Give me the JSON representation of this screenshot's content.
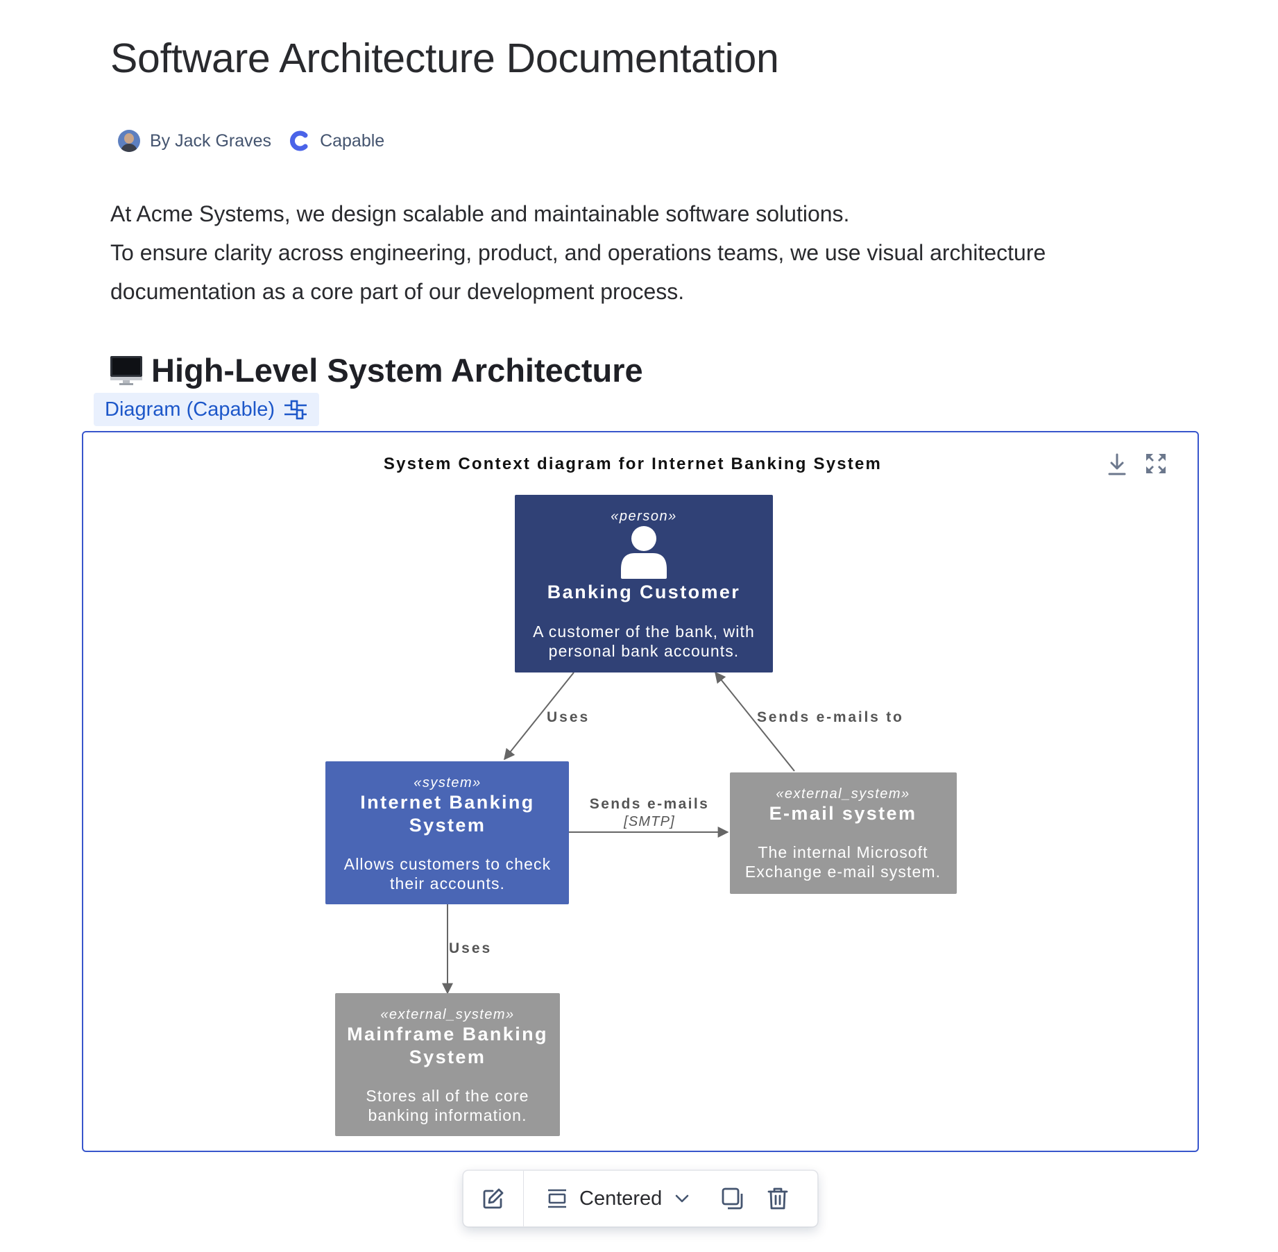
{
  "page": {
    "title": "Software Architecture Documentation",
    "byline": {
      "author": "By Jack Graves",
      "app_name": "Capable",
      "icons": [
        "author-avatar",
        "capable-logo-icon"
      ]
    },
    "intro_lines": [
      "At Acme Systems, we design scalable and maintainable software solutions.",
      "To ensure clarity across engineering, product, and operations teams, we use visual architecture documentation as a core part of our development process."
    ],
    "section_heading": "High-Level System Architecture",
    "section_heading_icon": "desktop-computer-icon",
    "macro_chip": {
      "label": "Diagram (Capable)",
      "icon": "settings-sliders-icon"
    }
  },
  "diagram": {
    "title": "System Context diagram for Internet Banking System",
    "tools": [
      "download-icon",
      "fullscreen-icon"
    ],
    "colors": {
      "person": "#304176",
      "system": "#4a66b5",
      "external": "#999999",
      "edge": "#666666"
    },
    "nodes": {
      "customer": {
        "stereotype": "«person»",
        "name": "Banking Customer",
        "desc": [
          "A customer of the bank, with",
          "personal bank accounts."
        ]
      },
      "ibs": {
        "stereotype": "«system»",
        "name": [
          "Internet Banking",
          "System"
        ],
        "desc": [
          "Allows customers to check",
          "their accounts."
        ]
      },
      "email": {
        "stereotype": "«external_system»",
        "name": "E-mail system",
        "desc": [
          "The internal Microsoft",
          "Exchange e-mail system."
        ]
      },
      "mainframe": {
        "stereotype": "«external_system»",
        "name": [
          "Mainframe Banking",
          "System"
        ],
        "desc": [
          "Stores all of the core",
          "banking information."
        ]
      }
    },
    "edges": {
      "customer_uses": "Uses",
      "email_sends": "Sends e-mails to",
      "ibs_sends": "Sends e-mails",
      "ibs_sends_tech": "[SMTP]",
      "ibs_uses": "Uses"
    }
  },
  "toolbar": {
    "layout_label": "Centered",
    "icons": [
      "edit-icon",
      "layout-centered-icon",
      "chevron-down-icon",
      "copy-icon",
      "delete-icon"
    ]
  }
}
